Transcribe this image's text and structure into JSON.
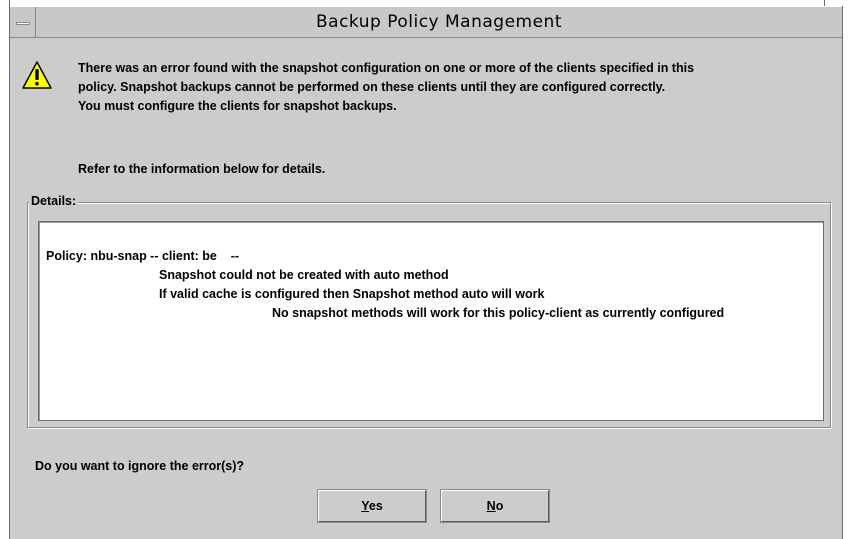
{
  "window": {
    "title": "Backup Policy Management"
  },
  "message": {
    "icon": "warning-icon",
    "lines": [
      "There was an error found with the snapshot configuration on one or more of the clients specified in this",
      "policy. Snapshot backups cannot be performed on these clients until they are configured correctly.",
      "You must configure the clients for snapshot backups."
    ],
    "refer": "Refer to the information below for details."
  },
  "details": {
    "label": "Details:",
    "lines": [
      "Policy: nbu-snap -- client: be    --",
      "Snapshot could not be created with auto method",
      "If valid cache is configured then Snapshot method auto will work",
      "No snapshot methods will work for this policy-client as currently configured"
    ]
  },
  "prompt": {
    "question": "Do you want to ignore the error(s)?"
  },
  "buttons": {
    "yes_mnemonic": "Y",
    "yes_rest": "es",
    "no_mnemonic": "N",
    "no_rest": "o"
  },
  "colors": {
    "window_bg": "#cccccc",
    "warning_fill": "#ffff00"
  }
}
